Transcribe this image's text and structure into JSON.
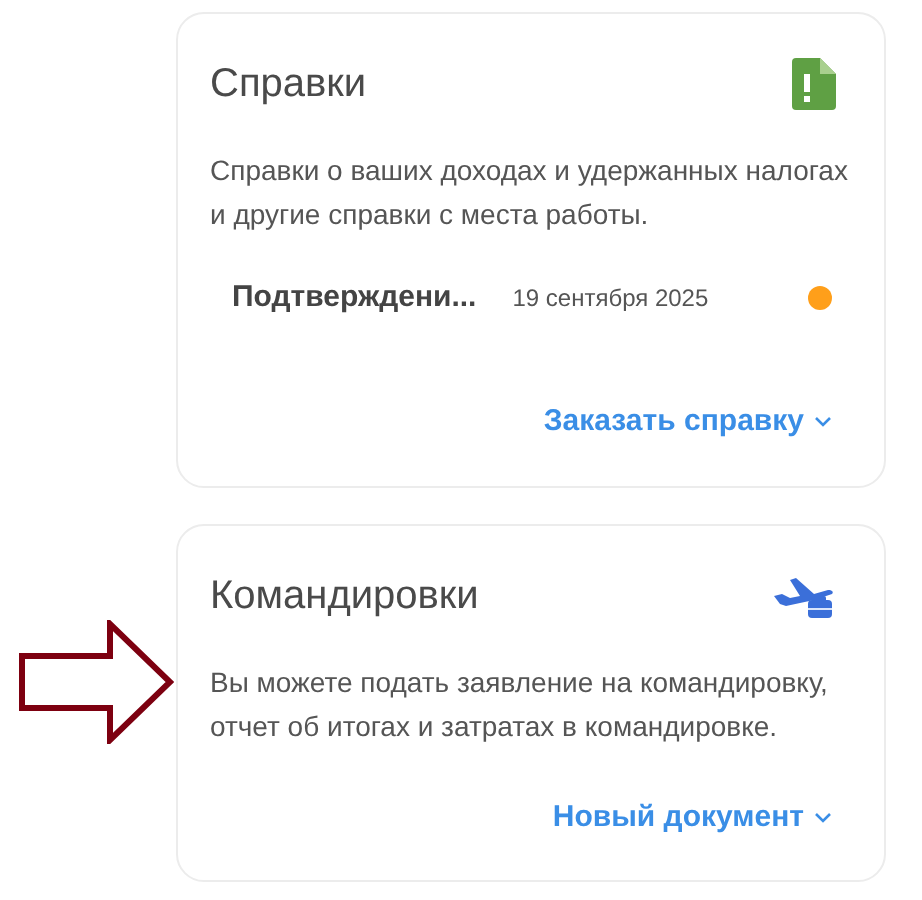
{
  "cards": [
    {
      "kind": "certificates",
      "title": "Справки",
      "description": "Справки о ваших доходах и удержанных налогах и другие справки с места работы.",
      "documents": [
        {
          "name": "Подтверждени...",
          "date": "19 сентября 2025",
          "color": "#ff9f1a"
        }
      ],
      "action": "Заказать справку"
    },
    {
      "kind": "trips",
      "title": "Командировки",
      "description": "Вы можете подать заявление на командировку, отчет об итогах и затратах в командировке.",
      "action": "Новый документ"
    }
  ]
}
